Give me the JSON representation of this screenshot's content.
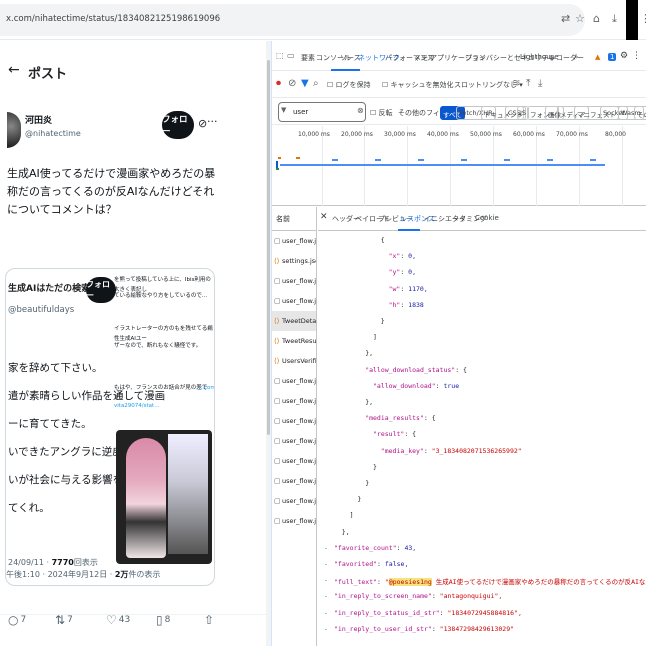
{
  "browser": {
    "url": "x.com/nihatectime/status/1834082125198619096"
  },
  "post": {
    "header_title": "ポスト",
    "user_name": "河田炎",
    "user_handle": "@nihatectime",
    "follow_label": "フォロー",
    "text": "生成AI使ってるだけで漫画家やめろだの暴称だの言ってくるのが反AIなんだけどそれについてコメントは？",
    "quote": {
      "name": "生成AIはただの検索エン…",
      "handle": "@beautifuldays",
      "follow_label": "フォロー",
      "side_lines": [
        "を熊って投稿している上に、Ibis利用の大きく表記し",
        "ている絵鞍なやり方をしているので…",
        "イラストレーターの方のもを残せてる鵜性生成AIユー",
        "ザーなので、断れもなく騒怪です。",
        "もはや、フランスのお話合が見の差です。",
        "x.com/",
        "vita29074/stat…"
      ],
      "body_lines": [
        "家を辞めて下さい。",
        "遣が素晴らしい作品を通して漫画",
        "ーに育ててきた。",
        "いできたアングラに逆戻り。",
        "いが社会に与える影響を考えられ",
        "てくれ。"
      ],
      "date_prefix": "24/09/11 · ",
      "views_count": "7770",
      "views_suffix": "回表示"
    },
    "meta_time": "午後1:10 · 2024年9月12日 · ",
    "meta_views": "2万",
    "meta_suffix": "件の表示",
    "actions": {
      "reply_count": "7",
      "repost_count": "7",
      "like_count": "43",
      "bookmark_count": "8"
    }
  },
  "devtools": {
    "tabs": [
      "要素",
      "コンソール",
      "ソース",
      "ネットワーク",
      "パフォーマンス",
      "メモリ",
      "アプリケーション",
      "プライバシーとセキュリティ",
      "Lighthouse",
      "レコーダー"
    ],
    "active_tab": "ネットワーク",
    "badge_count": "1",
    "toolbar": {
      "preserve_log": "ログを保持",
      "disable_cache": "キャッシュを無効化",
      "throttle": "スロットリングなし"
    },
    "filter_value": "user",
    "filter_invert": "反転",
    "filter_more": "その他のフィルタ ▾",
    "filter_chips": [
      "すべて",
      "Fetch/XHR",
      "ドキュメント",
      "CSS",
      "JS",
      "フォント",
      "画像",
      "メディア",
      "マニフェスト",
      "Socket",
      "Wasm",
      "その他"
    ],
    "timeline_labels": [
      "10,000 ms",
      "20,000 ms",
      "30,000 ms",
      "40,000 ms",
      "50,000 ms",
      "60,000 ms",
      "70,000 ms",
      "80,000"
    ],
    "name_header": "名前",
    "requests": [
      {
        "name": "user_flow.json",
        "type": "doc"
      },
      {
        "name": "settings.json?i…",
        "type": "xhr"
      },
      {
        "name": "user_flow.json",
        "type": "doc"
      },
      {
        "name": "user_flow.json",
        "type": "doc"
      },
      {
        "name": "TweetDetail?v…",
        "type": "xhr"
      },
      {
        "name": "TweetResultBy…",
        "type": "xhr"
      },
      {
        "name": "UsersVerifiedA…",
        "type": "xhr"
      },
      {
        "name": "user_flow.json",
        "type": "doc"
      },
      {
        "name": "user_flow.json",
        "type": "doc"
      },
      {
        "name": "user_flow.json",
        "type": "doc"
      },
      {
        "name": "user_flow.json",
        "type": "doc"
      },
      {
        "name": "user_flow.json",
        "type": "doc"
      },
      {
        "name": "user_flow.json",
        "type": "doc"
      },
      {
        "name": "user_flow.json",
        "type": "doc"
      },
      {
        "name": "user_flow.json",
        "type": "doc"
      }
    ],
    "selected_request": 4,
    "detail_tabs": [
      "ヘッダー",
      "ペイロード",
      "プレビュー",
      "レスポンス",
      "イニシエータ",
      "タイミング",
      "Cookie"
    ],
    "active_detail_tab": "レスポンス",
    "json_lines": [
      {
        "indent": 12,
        "t": "{"
      },
      {
        "indent": 14,
        "k": "\"x\"",
        "sep": ": ",
        "v": "0,",
        "vt": "num"
      },
      {
        "indent": 14,
        "k": "\"y\"",
        "sep": ": ",
        "v": "0,",
        "vt": "num"
      },
      {
        "indent": 14,
        "k": "\"w\"",
        "sep": ": ",
        "v": "1170,",
        "vt": "num"
      },
      {
        "indent": 14,
        "k": "\"h\"",
        "sep": ": ",
        "v": "1838",
        "vt": "num"
      },
      {
        "indent": 12,
        "t": "}"
      },
      {
        "indent": 10,
        "t": "]"
      },
      {
        "indent": 8,
        "t": "},"
      },
      {
        "indent": 8,
        "k": "\"allow_download_status\"",
        "sep": ": {",
        "v": "",
        "vt": ""
      },
      {
        "indent": 10,
        "k": "\"allow_download\"",
        "sep": ": ",
        "v": "true",
        "vt": "bool"
      },
      {
        "indent": 8,
        "t": "},"
      },
      {
        "indent": 8,
        "k": "\"media_results\"",
        "sep": ": {",
        "v": "",
        "vt": ""
      },
      {
        "indent": 10,
        "k": "\"result\"",
        "sep": ": {",
        "v": "",
        "vt": ""
      },
      {
        "indent": 12,
        "k": "\"media_key\"",
        "sep": ": ",
        "v": "\"3_1834082071536265992\"",
        "vt": "str"
      },
      {
        "indent": 10,
        "t": "}"
      },
      {
        "indent": 8,
        "t": "}"
      },
      {
        "indent": 6,
        "t": "}"
      },
      {
        "indent": 4,
        "t": "]"
      },
      {
        "indent": 2,
        "t": "},"
      },
      {
        "indent": 0,
        "dash": true,
        "k": "\"favorite_count\"",
        "sep": ": ",
        "v": "43,",
        "vt": "num"
      },
      {
        "indent": 0,
        "dash": true,
        "k": "\"favorited\"",
        "sep": ": ",
        "v": "false,",
        "vt": "bool"
      },
      {
        "indent": 0,
        "dash": true,
        "k": "\"full_text\"",
        "sep": ": ",
        "v": "\"@poesies1ng 生成AI使ってるだけで漫画家やめろだの暴称だの言ってくるのが反AIなんだけどそれについてコメントは？ https://t.co/1S2…",
        "vt": "str",
        "hl": "@poesies1ng"
      },
      {
        "indent": 0,
        "dash": true,
        "k": "\"in_reply_to_screen_name\"",
        "sep": ": ",
        "v": "\"antagonquigui\",",
        "vt": "str"
      },
      {
        "indent": 0,
        "dash": true,
        "k": "\"in_reply_to_status_id_str\"",
        "sep": ": ",
        "v": "\"1834072945884816\",",
        "vt": "str"
      },
      {
        "indent": 0,
        "dash": true,
        "k": "\"in_reply_to_user_id_str\"",
        "sep": ": ",
        "v": "\"13847298429613029\"",
        "vt": "str"
      }
    ]
  }
}
